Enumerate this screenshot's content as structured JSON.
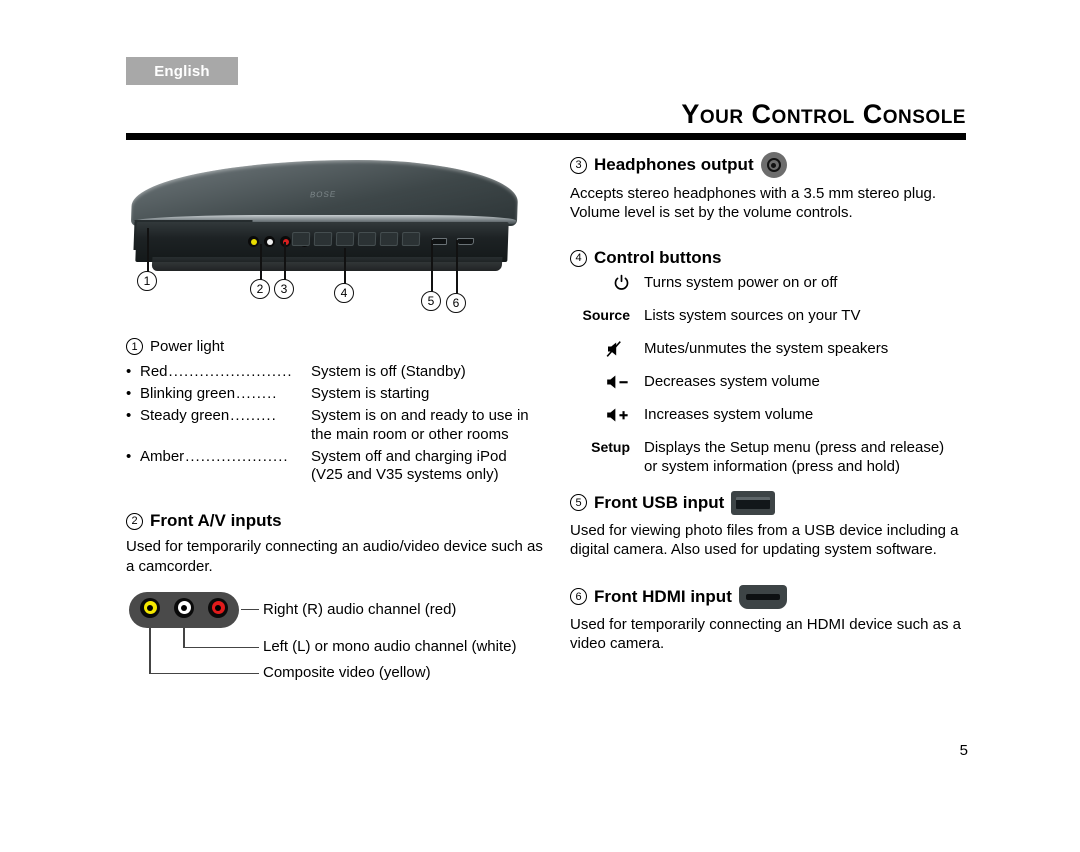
{
  "header": {
    "language_tab": "English",
    "title": "Your Control Console",
    "page_number": "5"
  },
  "illustration": {
    "brand_logo": "BOSE",
    "callouts": [
      "1",
      "2",
      "3",
      "4",
      "5",
      "6"
    ]
  },
  "left_column": {
    "power_light": {
      "number": "1",
      "title": "Power light",
      "states": [
        {
          "label": "Red",
          "dots": "........................",
          "desc": "System is off (Standby)",
          "cont": ""
        },
        {
          "label": "Blinking green",
          "dots": "........",
          "desc": "System is starting",
          "cont": ""
        },
        {
          "label": "Steady green",
          "dots": ".........",
          "desc": "System is on and ready to use in",
          "cont": "the main room or other rooms"
        },
        {
          "label": "Amber",
          "dots": "....................",
          "desc": "System off and charging iPod",
          "cont": "(V25 and V35 systems only)"
        }
      ]
    },
    "av_inputs": {
      "number": "2",
      "title": "Front A/V inputs",
      "description": "Used for temporarily connecting an audio/video device such as a camcorder.",
      "jacks": [
        {
          "name": "composite-video",
          "color": "#f5e800",
          "label": "Composite video (yellow)"
        },
        {
          "name": "left-mono-audio",
          "color": "#ffffff",
          "label": "Left (L) or mono audio channel (white)"
        },
        {
          "name": "right-audio",
          "color": "#e01b1b",
          "label": "Right (R) audio channel (red)"
        }
      ]
    }
  },
  "right_column": {
    "headphones": {
      "number": "3",
      "title": "Headphones output",
      "icon": "headphone-jack-icon",
      "description": "Accepts stereo headphones with a 3.5 mm stereo plug. Volume level is set by the volume controls."
    },
    "control_buttons": {
      "number": "4",
      "title": "Control buttons",
      "rows": [
        {
          "key": "",
          "icon": "power-icon",
          "desc": "Turns system power on or off",
          "cont": ""
        },
        {
          "key": "Source",
          "icon": "",
          "desc": "Lists system sources on your TV",
          "cont": ""
        },
        {
          "key": "",
          "icon": "mute-icon",
          "desc": "Mutes/unmutes the system speakers",
          "cont": ""
        },
        {
          "key": "",
          "icon": "volume-down-icon",
          "desc": "Decreases system volume",
          "cont": ""
        },
        {
          "key": "",
          "icon": "volume-up-icon",
          "desc": "Increases system volume",
          "cont": ""
        },
        {
          "key": "Setup",
          "icon": "",
          "desc": "Displays the Setup menu (press and release)",
          "cont": "or system information (press and hold)"
        }
      ]
    },
    "usb_input": {
      "number": "5",
      "title": "Front USB input",
      "icon": "usb-port-icon",
      "description": "Used for viewing photo files from a USB device including a digital camera. Also used for updating system software."
    },
    "hdmi_input": {
      "number": "6",
      "title": "Front HDMI input",
      "icon": "hdmi-port-icon",
      "description": "Used for temporarily connecting an HDMI device such as a video camera."
    }
  }
}
